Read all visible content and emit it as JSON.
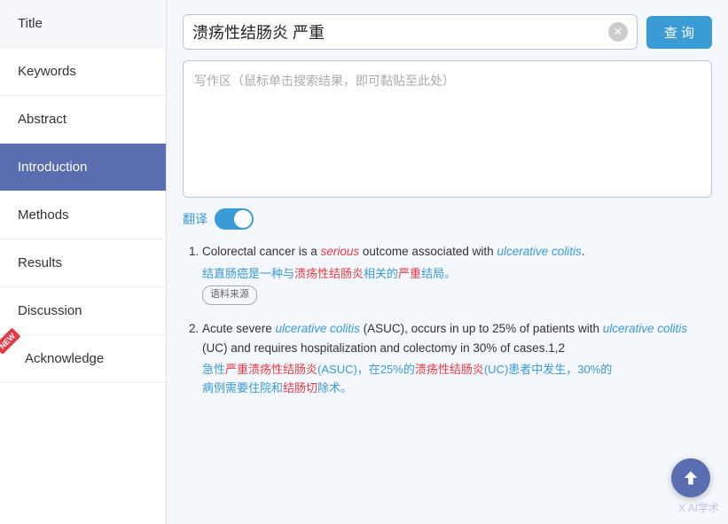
{
  "sidebar": {
    "items": [
      {
        "label": "Title",
        "active": false,
        "new": false
      },
      {
        "label": "Keywords",
        "active": false,
        "new": false
      },
      {
        "label": "Abstract",
        "active": false,
        "new": false
      },
      {
        "label": "Introduction",
        "active": true,
        "new": false
      },
      {
        "label": "Methods",
        "active": false,
        "new": false
      },
      {
        "label": "Results",
        "active": false,
        "new": false
      },
      {
        "label": "Discussion",
        "active": false,
        "new": false
      },
      {
        "label": "Acknowledge",
        "active": false,
        "new": true
      }
    ]
  },
  "search": {
    "query": "溃疡性结肠炎 严重",
    "button_label": "查 询",
    "clear_title": "clear"
  },
  "writing_area": {
    "placeholder": "写作区（鼠标单击搜索结果，即可黏贴至此处）"
  },
  "translate": {
    "label": "翻译",
    "enabled": true
  },
  "results": [
    {
      "num": "1",
      "en_parts": [
        {
          "text": "Colorectal cancer is a ",
          "style": "normal"
        },
        {
          "text": "serious",
          "style": "italic-red"
        },
        {
          "text": " outcome associated with ",
          "style": "normal"
        },
        {
          "text": "ulcerative colitis",
          "style": "italic-blue"
        },
        {
          "text": ".",
          "style": "normal"
        }
      ],
      "zh": "结直肠癌是一种与溃疡性结肠炎相关的严重结局。",
      "zh_parts": [
        {
          "text": "结直肠癌是一种与",
          "style": "normal"
        },
        {
          "text": "溃疡性结肠炎",
          "style": "red"
        },
        {
          "text": "相关的",
          "style": "normal"
        },
        {
          "text": "严重",
          "style": "red"
        },
        {
          "text": "结局。",
          "style": "normal"
        }
      ],
      "source_tag": "语料来源"
    },
    {
      "num": "2",
      "en_parts": [
        {
          "text": "Acute severe ",
          "style": "normal"
        },
        {
          "text": "ulcerative colitis",
          "style": "italic-blue"
        },
        {
          "text": " (ASUC), occurs in up to 25% of patients wi\nth ",
          "style": "normal"
        },
        {
          "text": "ulcerative colitis",
          "style": "italic-blue"
        },
        {
          "text": " (UC) and requires hospitalization and colectomy in 3\n0% of cases.1,2",
          "style": "normal"
        }
      ],
      "zh_parts": [
        {
          "text": "急性",
          "style": "normal"
        },
        {
          "text": "严重溃疡性结肠炎",
          "style": "red"
        },
        {
          "text": "(ASUC)，在25%的",
          "style": "normal"
        },
        {
          "text": "溃疡性结肠炎",
          "style": "red"
        },
        {
          "text": "(UC)患者中发生，",
          "style": "normal"
        },
        {
          "text": "30%",
          "style": "normal"
        },
        {
          "text": "的\n病例需要住院和",
          "style": "normal"
        },
        {
          "text": "结肠切",
          "style": "red"
        },
        {
          "text": "除术。",
          "style": "normal"
        }
      ],
      "source_tag": null
    }
  ],
  "scroll_up_title": "Scroll to top",
  "watermark": "X AI学术"
}
